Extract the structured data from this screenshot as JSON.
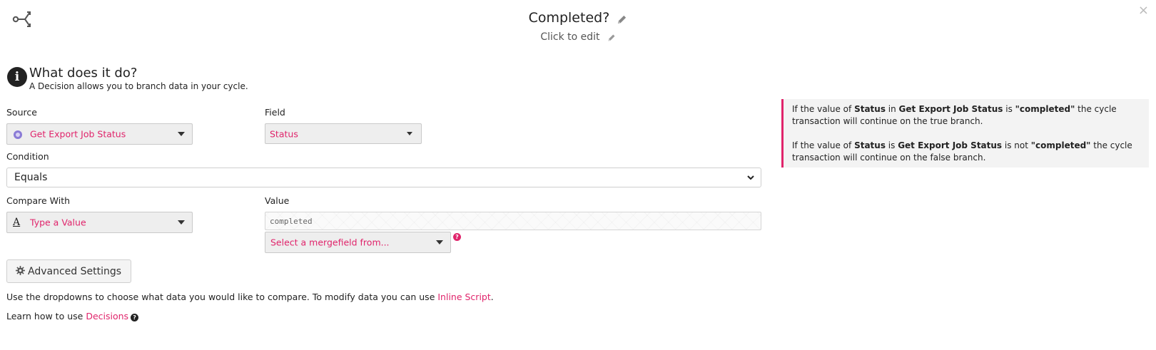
{
  "header": {
    "title": "Completed?",
    "subtitle": "Click to edit",
    "close_glyph": "×"
  },
  "info": {
    "icon_glyph": "i",
    "heading": "What does it do?",
    "description": "A Decision allows you to branch data in your cycle."
  },
  "form": {
    "source_label": "Source",
    "source_value": "Get Export Job Status",
    "field_label": "Field",
    "field_value": "Status",
    "condition_label": "Condition",
    "condition_value": "Equals",
    "compare_label": "Compare With",
    "compare_icon": "A",
    "compare_value": "Type a Value",
    "value_label": "Value",
    "value_input": "completed",
    "mergefield_placeholder": "Select a mergefield from..."
  },
  "advanced_button_label": "Advanced Settings",
  "help": {
    "line1_text": "Use the dropdowns to choose what data you would like to compare. To modify data you can use ",
    "line1_link": "Inline Script",
    "line1_end": ".",
    "line2_text": "Learn how to use ",
    "line2_link": "Decisions",
    "help_glyph": "?"
  },
  "summary": {
    "true_branch": {
      "p1": "If the value of ",
      "field": "Status",
      "p2": " in ",
      "source": "Get Export Job Status",
      "p3": " is ",
      "value": "\"completed\"",
      "p4": " the cycle transaction will continue on the true branch."
    },
    "false_branch": {
      "p1": "If the value of ",
      "field": "Status",
      "p2": " is ",
      "source": "Get Export Job Status",
      "p3": " is not ",
      "value": "\"completed\"",
      "p4": " the cycle transaction will continue on the false branch."
    }
  },
  "colors": {
    "accent": "#e0246b",
    "select_bg": "#eeeeee",
    "panel_bg": "#f3f3f3"
  },
  "icons": [
    "decision-branch-icon",
    "pencil-icon",
    "close-icon",
    "info-icon",
    "app-icon",
    "text-a-icon",
    "chevron-down-icon",
    "help-icon",
    "gear-icon"
  ]
}
